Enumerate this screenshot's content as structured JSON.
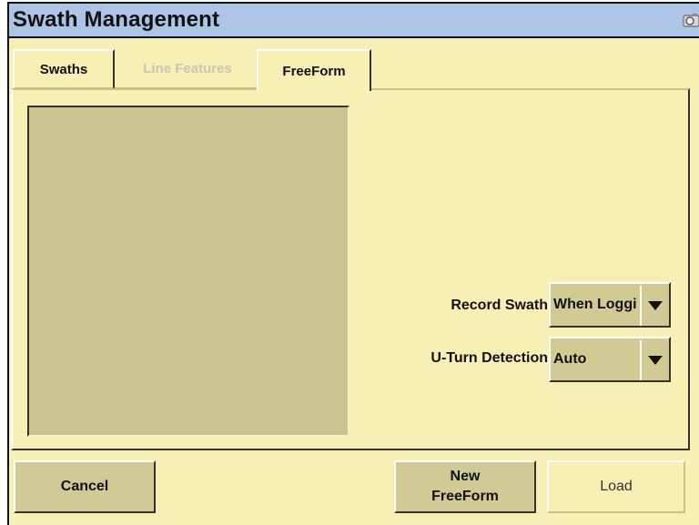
{
  "window": {
    "title": "Swath Management"
  },
  "tabs": [
    {
      "label": "Swaths",
      "state": "inactive"
    },
    {
      "label": "Line Features",
      "state": "disabled"
    },
    {
      "label": "FreeForm",
      "state": "active"
    }
  ],
  "fields": {
    "record_swath": {
      "label": "Record Swath",
      "value": "When Loggi"
    },
    "uturn_detection": {
      "label": "U-Turn Detection",
      "value": "Auto"
    }
  },
  "buttons": {
    "cancel": "Cancel",
    "new_line1": "New",
    "new_line2": "FreeForm",
    "load": "Load"
  },
  "icons": {
    "titlebar": "camera-icon",
    "dropdown": "triangle-down-icon"
  },
  "colors": {
    "background": "#f7f0b4",
    "titlebar": "#aec4e6",
    "control": "#d0cb95",
    "preview": "#c8c48e",
    "disabled_text": "#c9c5b2"
  }
}
